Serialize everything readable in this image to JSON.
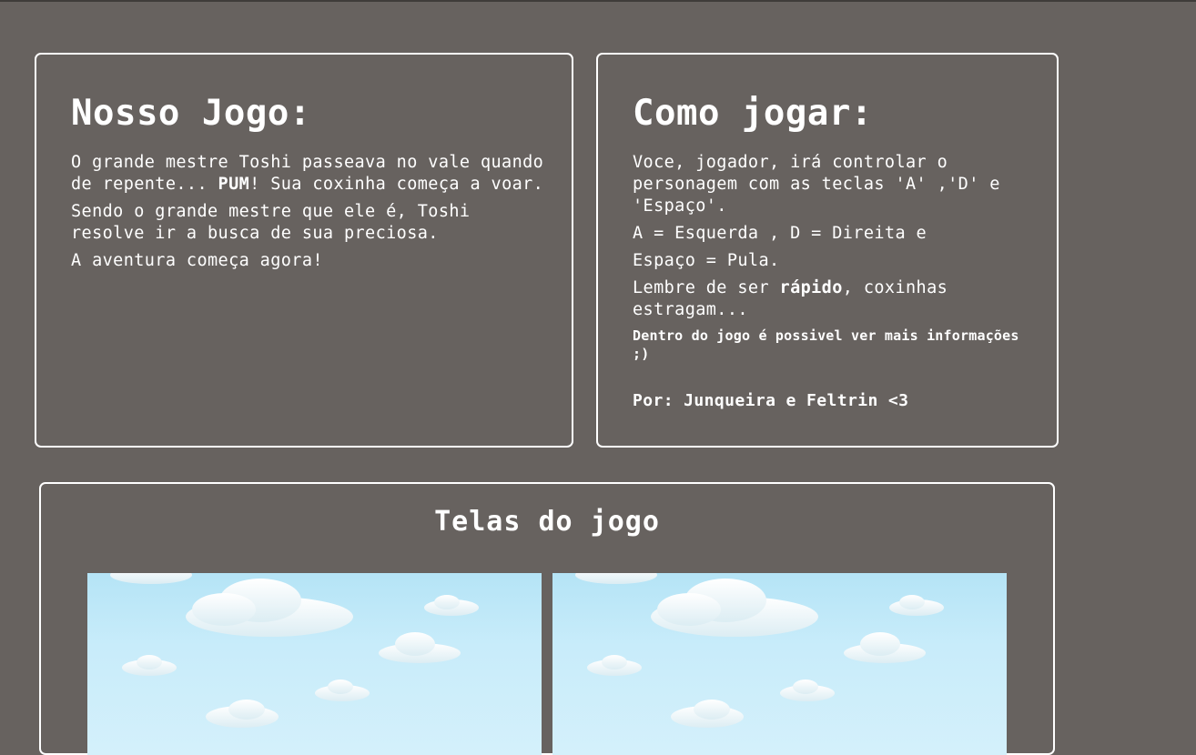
{
  "nosso_jogo": {
    "title": "Nosso Jogo:",
    "p1_before": "O grande mestre Toshi passeava no vale quando de repente... ",
    "p1_bold": "PUM",
    "p1_after": "! Sua coxinha começa a voar.",
    "p2": "Sendo o grande mestre que ele é, Toshi resolve ir a busca de sua preciosa.",
    "p3": "A aventura começa agora!"
  },
  "como_jogar": {
    "title": "Como jogar:",
    "p1": "Voce, jogador, irá controlar o personagem com as teclas 'A' ,'D' e 'Espaço'.",
    "p2": "A = Esquerda , D = Direita e",
    "p3": "Espaço = Pula.",
    "p4_before": "Lembre de ser ",
    "p4_bold": "rápido",
    "p4_after": ", coxinhas estragam...",
    "note": "Dentro do jogo é possivel ver mais informações ;)",
    "credits": "Por: Junqueira e Feltrin <3"
  },
  "telas": {
    "title": "Telas do jogo",
    "screenshots": [
      "sky-clouds-screenshot",
      "sky-clouds-screenshot"
    ]
  },
  "colors": {
    "background": "#67625f",
    "border": "#ffffff",
    "text": "#ffffff",
    "sky": "#c2e9f9"
  }
}
